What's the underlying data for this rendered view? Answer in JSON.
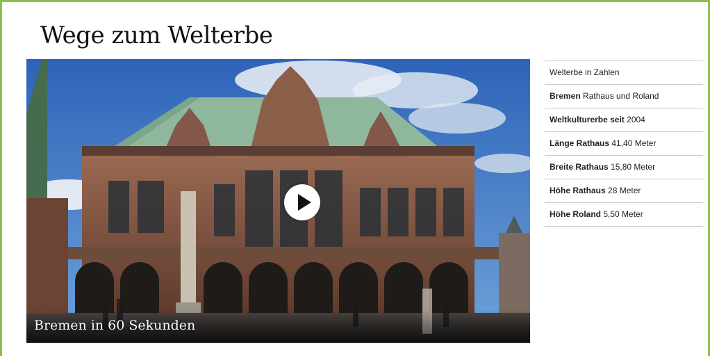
{
  "page": {
    "title": "Wege zum Welterbe",
    "accent_color": "#8cc04b"
  },
  "video": {
    "caption": "Bremen in 60 Sekunden",
    "play_icon": "play-icon"
  },
  "facts": {
    "header": "Welterbe in Zahlen",
    "items": [
      {
        "label": "Bremen",
        "value": "Rathaus und Roland"
      },
      {
        "label": "Weltkulturerbe seit",
        "value": "2004"
      },
      {
        "label": "Länge Rathaus",
        "value": "41,40 Meter"
      },
      {
        "label": "Breite Rathaus",
        "value": "15,80 Meter"
      },
      {
        "label": "Höhe Rathaus",
        "value": "28 Meter"
      },
      {
        "label": "Höhe Roland",
        "value": "5,50 Meter"
      }
    ]
  }
}
